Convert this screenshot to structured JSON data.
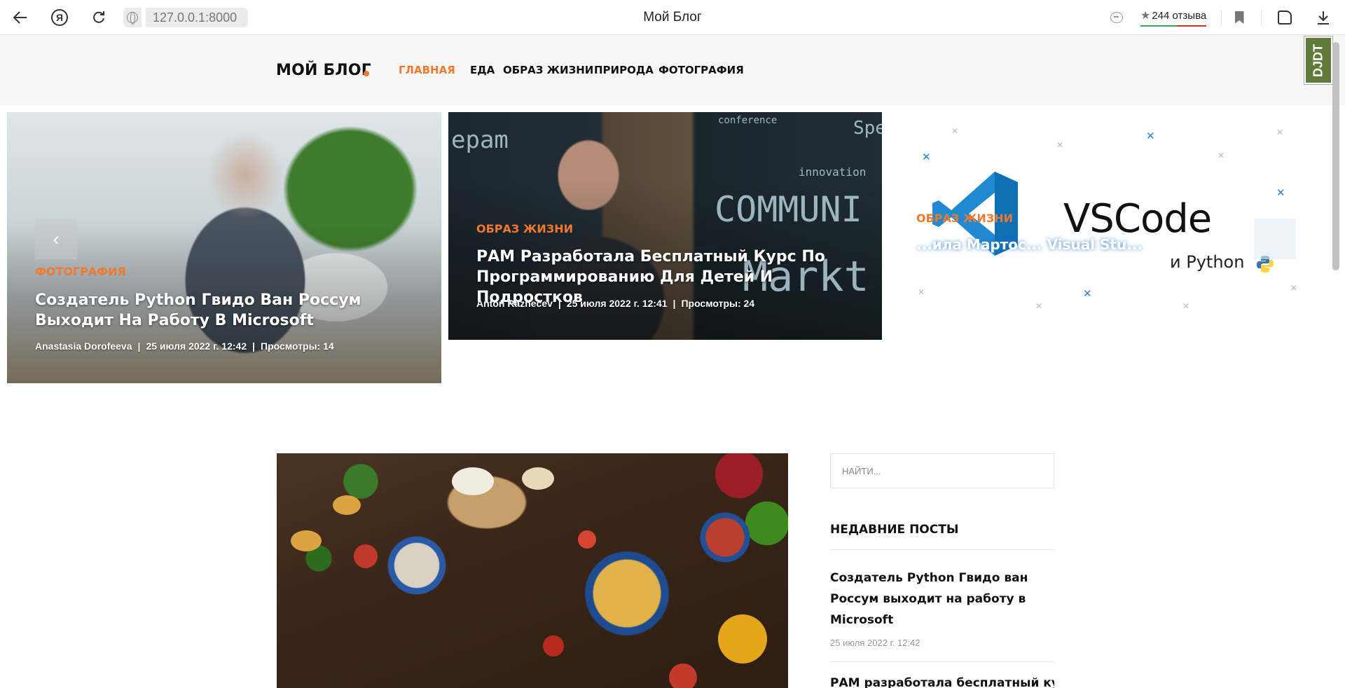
{
  "browser": {
    "address": "127.0.0.1:8000",
    "tab_title": "Мой Блог",
    "reviews": "244 отзыва",
    "yandex_letter": "Я",
    "icons": [
      "back-arrow-icon",
      "yandex-icon",
      "reload-icon",
      "site-info-icon",
      "chat-icon",
      "star-icon",
      "bookmark-icon",
      "extensions-icon",
      "download-icon"
    ]
  },
  "header": {
    "logo": "МОЙ БЛОГ",
    "nav": [
      "ГЛАВНАЯ",
      "ЕДА",
      "ОБРАЗ ЖИЗНИ",
      "ПРИРОДА",
      "ФОТОГРАФИЯ"
    ],
    "active_nav": "ГЛАВНАЯ",
    "accent_color": "#f0792e",
    "debug_toolbar": "DJDT"
  },
  "slider": {
    "prev_label": "‹",
    "slides": [
      {
        "category": "ФОТОГРАФИЯ",
        "title": "Создатель Python Гвидо Ван Россум Выходит На Работу В Microsoft",
        "author": "Anastasia Dorofeeva",
        "date": "25 июля 2022 г. 12:42",
        "views": "Просмотры: 14"
      },
      {
        "category": "ОБРАЗ ЖИЗНИ",
        "title": "РАМ Разработала Бесплатный Курс По Программированию Для Детей И Подростков",
        "author": "Anton Raznecev",
        "date": "25 июля 2022 г. 12:41",
        "views": "Просмотры: 24",
        "chalk": [
          "epam",
          "conference",
          "innovation",
          "COMMUNI",
          "Spe",
          "Markt"
        ]
      },
      {
        "category": "ОБРАЗ ЖИЗНИ",
        "title": "...ила Мартос... Visual Stu...",
        "image_text": "VSCode",
        "image_sub": "и Python"
      }
    ]
  },
  "sidebar": {
    "search_placeholder": "НАЙТИ...",
    "recent_title": "НЕДАВНИЕ ПОСТЫ",
    "recent_posts": [
      {
        "title": "Создатель Python Гвидо ван Россум выходит на работу в Microsoft",
        "date": "25 июля 2022 г. 12:42"
      },
      {
        "title": "РАМ разработала бесплатный курс"
      }
    ]
  }
}
